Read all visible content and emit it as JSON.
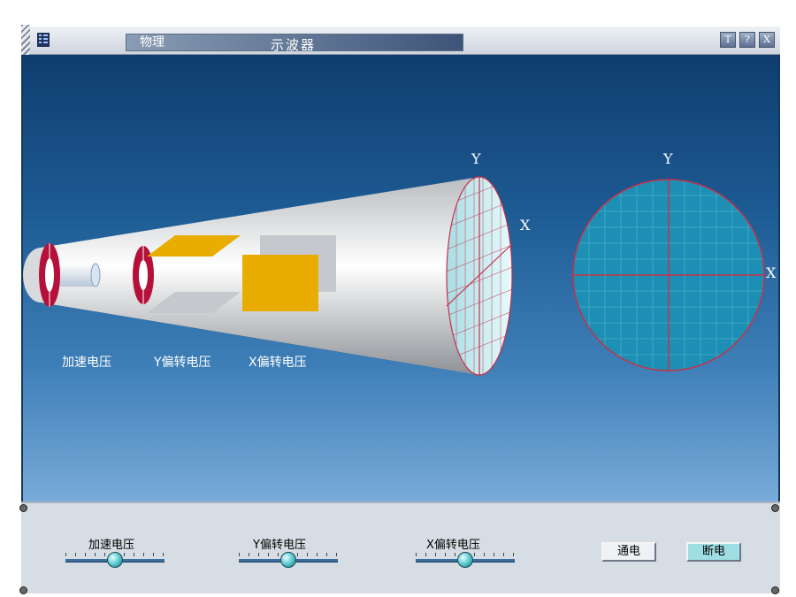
{
  "window": {
    "subject": "物理",
    "title": "示波器",
    "buttons": [
      "T",
      "?",
      "X"
    ]
  },
  "simulation": {
    "axis_y": "Y",
    "axis_x": "X",
    "screen_axis_y": "Y",
    "screen_axis_x": "X",
    "labels": {
      "accel": "加速电压",
      "y_deflect": "Y偏转电压",
      "x_deflect": "X偏转电压"
    }
  },
  "controls": {
    "sliders": [
      {
        "label": "加速电压",
        "value": 0.5
      },
      {
        "label": "Y偏转电压",
        "value": 0.5
      },
      {
        "label": "X偏转电压",
        "value": 0.5
      }
    ],
    "power_on": "通电",
    "power_off": "断电"
  },
  "colors": {
    "accent": "#1d5b93",
    "plate": "#e8ad00",
    "ring": "#b5103a",
    "screen": "#1d8fb5",
    "grid_line": "#c8304a"
  }
}
